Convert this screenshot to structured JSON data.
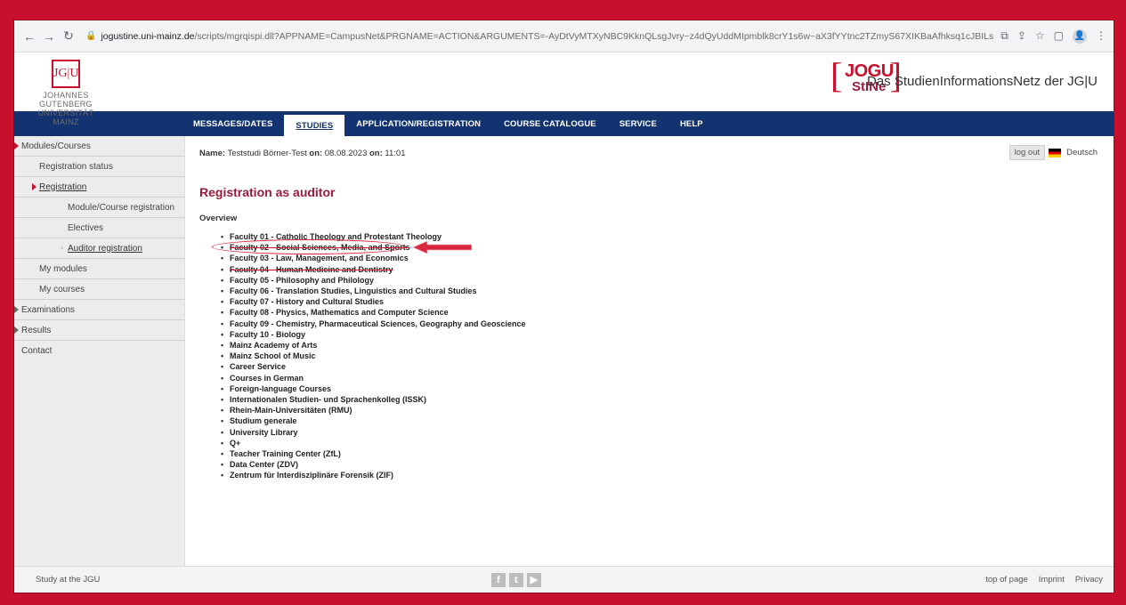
{
  "browser": {
    "url_domain": "jogustine.uni-mainz.de",
    "url_path": "/scripts/mgrqispi.dll?APPNAME=CampusNet&PRGNAME=ACTION&ARGUMENTS=-AyDtVyMTXyNBC9KknQLsgJvry~z4dQyUddMIpmblk8crY1s6w~aX3fYYtnc2TZmyS67XIKBaAfhksq1cJBILsExQIFMDm7nmYEY~~7xUB7WjPsGAKEN8..."
  },
  "header": {
    "jgu_mark": "JG|U",
    "jgu_line1": "JOHANNES GUTENBERG",
    "jgu_line2": "UNIVERSITÄT MAINZ",
    "stine_logo_top": "JOGU",
    "stine_logo_bottom": "StINe",
    "tagline": "Das StudienInformationsNetz der JG|U"
  },
  "topnav": {
    "items": [
      "MESSAGES/DATES",
      "STUDIES",
      "APPLICATION/REGISTRATION",
      "COURSE CATALOGUE",
      "SERVICE",
      "HELP"
    ],
    "active": "STUDIES"
  },
  "sidebar": {
    "items": [
      {
        "label": "Modules/Courses"
      },
      {
        "label": "Registration status"
      },
      {
        "label": "Registration"
      },
      {
        "label": "Module/Course registration"
      },
      {
        "label": "Electives"
      },
      {
        "label": "Auditor registration"
      },
      {
        "label": "My modules"
      },
      {
        "label": "My courses"
      },
      {
        "label": "Examinations"
      },
      {
        "label": "Results"
      },
      {
        "label": "Contact"
      }
    ]
  },
  "main": {
    "name_label": "Name:",
    "name_value": "Teststudi Börner-Test",
    "on_label": "on:",
    "date": "08.08.2023",
    "time": "11:01",
    "logout": "log out",
    "language": "Deutsch",
    "title": "Registration as auditor",
    "overview": "Overview",
    "faculties": [
      "Faculty 01 - Catholic Theology and Protestant Theology",
      "Faculty 02 - Social Sciences, Media, and Sports",
      "Faculty 03 - Law, Management, and Economics",
      "Faculty 04 - Human Medicine and Dentistry",
      "Faculty 05 - Philosophy and Philology",
      "Faculty 06 - Translation Studies, Linguistics and Cultural Studies",
      "Faculty 07 - History and Cultural Studies",
      "Faculty 08 - Physics, Mathematics and Computer Science",
      "Faculty 09 - Chemistry, Pharmaceutical Sciences, Geography and Geoscience",
      "Faculty 10 - Biology",
      "Mainz Academy of Arts",
      "Mainz School of Music",
      "Career Service",
      "Courses in German",
      "Foreign-language Courses",
      "Internationalen Studien- und Sprachenkolleg (ISSK)",
      "Rhein-Main-Universitäten (RMU)",
      "Studium generale",
      "University Library",
      "Q+",
      "Teacher Training Center (ZfL)",
      "Data Center (ZDV)",
      "Zentrum für Interdisziplinäre Forensik (ZIF)"
    ],
    "highlight_color": "#d7263d"
  },
  "footer": {
    "left": "Study at the JGU",
    "social": [
      "f",
      "t",
      "▶"
    ],
    "top_of_page": "top of page",
    "imprint": "Imprint",
    "privacy": "Privacy"
  },
  "colors": {
    "brand_red": "#c8102e",
    "nav_blue": "#12336f",
    "title_red": "#9b1b3b"
  }
}
